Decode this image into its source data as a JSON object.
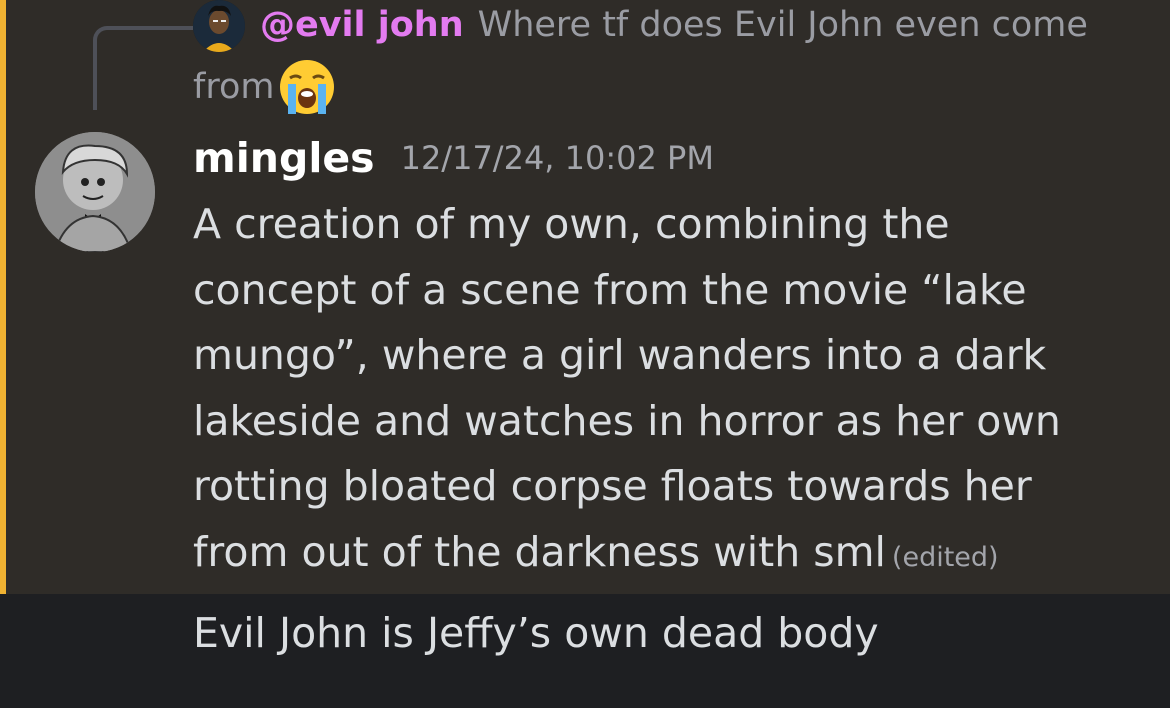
{
  "reply": {
    "author": "@evil john",
    "preview": "Where tf does Evil John even come",
    "preview_cont": "from",
    "emoji": "loudly-crying-face"
  },
  "message": {
    "author": "mingles",
    "timestamp": "12/17/24, 10:02 PM",
    "lines": [
      "A creation of my own, combining the",
      "concept of a scene from the movie “lake",
      "mungo”, where a girl wanders into a dark",
      "lakeside and watches in horror as her own",
      "rotting bloated corpse floats towards her",
      "from out of the darkness with sml"
    ],
    "edited_label": "(edited)"
  },
  "followup": {
    "text": "Evil John is Jeffy’s own dead body"
  },
  "colors": {
    "mention_accent": "#f0b232",
    "highlight_bg": "#2f2c28",
    "reply_author": "#e37bf0",
    "background": "#1e1f22"
  }
}
